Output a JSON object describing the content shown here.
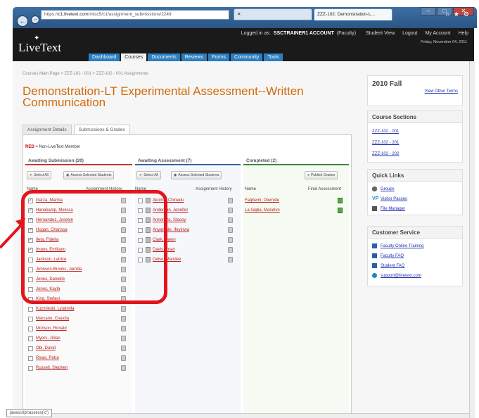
{
  "browser": {
    "url_prefix": "https://",
    "url_domain": "c1.livetext.com",
    "url_rest": "/misc5/c1/assignment_submissions/2249",
    "tab_active": "ZZZ-102: Demonstration-L...",
    "status_text": "javascript:assess('c')"
  },
  "header": {
    "logo": "LiveText",
    "logged_in": "Logged in as:",
    "account": "SSCTRAINER1 ACCOUNT",
    "role": "(Faculty)",
    "links": [
      "Student View",
      "Logout",
      "My Account",
      "Help"
    ],
    "date": "Friday, November 04, 2011",
    "nav": [
      "Dashboard",
      "Courses",
      "Documents",
      "Reviews",
      "Forms",
      "Community",
      "Tools"
    ]
  },
  "breadcrumb": "Courses Main Page  >  ZZZ-102 - 001  >  ZZZ-102 - 001 Assignments",
  "page_title": "Demonstration-LT Experimental Assessment--Written Communication",
  "subtabs": [
    "Assignment Details",
    "Submissions & Grades"
  ],
  "legend": {
    "red": "RED",
    "text": " = Non-LiveText Member"
  },
  "columns": {
    "awaiting_submission": {
      "header": "Awaiting Submission (20)",
      "select_all": "Select All",
      "assess": "Assess Selected Students",
      "name_label": "Name",
      "history_label": "Assignment History",
      "students": [
        {
          "name": "Garza, Marina",
          "checked": true
        },
        {
          "name": "Hanekamp, Melissa",
          "checked": true
        },
        {
          "name": "Hernandez, Joselyn",
          "checked": true
        },
        {
          "name": "Hogan, Charissa",
          "checked": true
        },
        {
          "name": "Ileta, Fidelia",
          "checked": true
        },
        {
          "name": "Impov, Emiliano",
          "checked": true
        },
        {
          "name": "Jackson, Latrice",
          "checked": false
        },
        {
          "name": "Johnson-Brooks, Jamilla",
          "checked": false
        },
        {
          "name": "Jones, Danielle",
          "checked": false
        },
        {
          "name": "Jones, Kayla",
          "checked": false
        },
        {
          "name": "King, Stefani",
          "checked": false
        },
        {
          "name": "Kuzmieski, Lyudmila",
          "checked": false
        },
        {
          "name": "Marcano, Claudia",
          "checked": false
        },
        {
          "name": "Monson, Ronald",
          "checked": false
        },
        {
          "name": "Myers, Jillian",
          "checked": false
        },
        {
          "name": "Obi, David",
          "checked": false
        },
        {
          "name": "Rivas, Petra",
          "checked": false
        },
        {
          "name": "Russell, Stephen",
          "checked": false
        }
      ]
    },
    "awaiting_assessment": {
      "header": "Awaiting Assessment (7)",
      "select_all": "Select All",
      "assess": "Assess Selected Students",
      "name_label": "Name",
      "history_label": "Assignment History",
      "students": [
        {
          "name": "Akoma, Chinedu"
        },
        {
          "name": "Anderson, Jennifer"
        },
        {
          "name": "Annorens, Stacey"
        },
        {
          "name": "Anyamele, Ifeyinwa"
        },
        {
          "name": "Clark, Dawn"
        },
        {
          "name": "Davis, Iman"
        },
        {
          "name": "Delso, Mandee"
        }
      ]
    },
    "completed": {
      "header": "Completed (2)",
      "publish": "Publish Grades",
      "name_label": "Name",
      "final_label": "Final Assessment",
      "students": [
        {
          "name": "Fagbemi, Olumide"
        },
        {
          "name": "La Giglia, Marielvn"
        }
      ]
    }
  },
  "sidebar": {
    "term": "2010 Fall",
    "other_terms": "View Other Terms",
    "sections_title": "Course Sections",
    "sections": [
      "ZZZ-102 - 001",
      "ZZZ-102 - 201",
      "ZZZ-102 - 202"
    ],
    "quick_title": "Quick Links",
    "quick": [
      {
        "label": "Groups",
        "icon": "group-icon"
      },
      {
        "label": "Visitor Passes",
        "icon": "visitor-pass-icon"
      },
      {
        "label": "File Manager",
        "icon": "file-manager-icon"
      }
    ],
    "service_title": "Customer Service",
    "service": [
      {
        "label": "Faculty Online Training",
        "icon": "training-icon"
      },
      {
        "label": "Faculty FAQ",
        "icon": "faq-icon"
      },
      {
        "label": "Student FAQ",
        "icon": "faq-icon"
      },
      {
        "label": "support@livetext.com",
        "icon": "help-icon"
      }
    ]
  },
  "colors": {
    "accent_orange": "#d06b0b",
    "annotation_red": "#e3141c",
    "nav_blue": "#2b7fc1"
  }
}
